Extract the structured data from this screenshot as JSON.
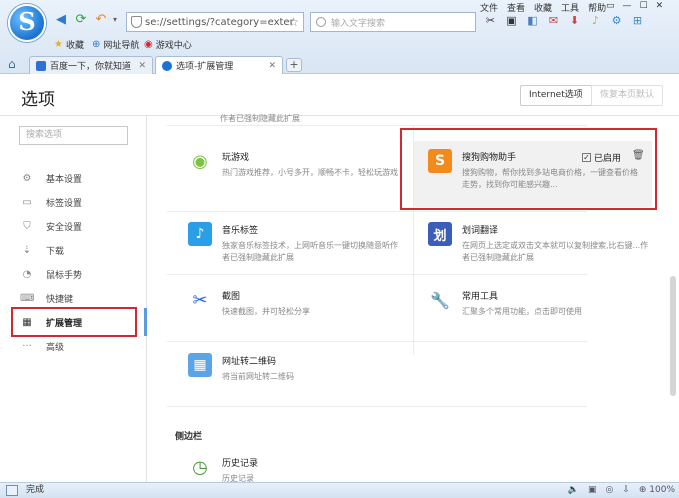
{
  "browser": {
    "logo_letter": "S",
    "address_url": "se://settings/?category=exter",
    "search_placeholder": "输入文字搜索",
    "menu": [
      "文件",
      "查看",
      "收藏",
      "工具",
      "帮助"
    ],
    "window_controls": [
      "▭",
      "—",
      "☐",
      "✕"
    ],
    "toolbar_icons": [
      "✂",
      "▣",
      "◧",
      "✉",
      "⬇",
      "♪",
      "⚙",
      "⊞"
    ],
    "bookmarks": [
      {
        "icon": "★",
        "label": "收藏"
      },
      {
        "icon": "⊕",
        "label": "网址导航"
      },
      {
        "icon": "◉",
        "label": "游戏中心"
      }
    ],
    "tabs": [
      {
        "label": "百度一下，你就知道",
        "active": false,
        "favicon_color": "#2f6fd6"
      },
      {
        "label": "选项-扩展管理",
        "active": true,
        "favicon_color": "#1a73d0"
      }
    ],
    "new_tab": "+"
  },
  "page": {
    "title": "选项",
    "internet_button": "Internet选项",
    "restore_button": "恢复本页默认",
    "sidebar_search_placeholder": "搜索选项",
    "sidebar": [
      {
        "icon": "⚙",
        "label": "基本设置"
      },
      {
        "icon": "▭",
        "label": "标签设置"
      },
      {
        "icon": "⛉",
        "label": "安全设置"
      },
      {
        "icon": "⇣",
        "label": "下载"
      },
      {
        "icon": "◔",
        "label": "鼠标手势"
      },
      {
        "icon": "⌨",
        "label": "快捷键"
      },
      {
        "icon": "▦",
        "label": "扩展管理"
      },
      {
        "icon": "···",
        "label": "高级"
      }
    ],
    "active_sidebar": "扩展管理",
    "top_partial_desc": "作者已强制隐藏此扩展",
    "extensions": [
      {
        "title": "玩游戏",
        "desc": "热门游戏推荐，小号多开，顺畅不卡，轻松玩游戏",
        "icon": "◉",
        "color": "#7cc243"
      },
      {
        "title": "搜狗购物助手",
        "desc": "搜狗购物，帮你找到多站电商价格，一键查看价格走势，找到你可能感兴趣...",
        "icon": "S",
        "color": "#f28a1c",
        "enabled_label": "已启用"
      },
      {
        "title": "音乐标签",
        "desc": "独家音乐标签技术，上网听音乐一键切换随意听作者已强制隐藏此扩展",
        "icon": "♪",
        "color": "#2a9ee6"
      },
      {
        "title": "划词翻译",
        "desc": "在网页上选定或双击文本就可以复制搜索,比右键...作者已强制隐藏此扩展",
        "icon": "划",
        "color": "#3b5fb8"
      },
      {
        "title": "截图",
        "desc": "快速截图，并可轻松分享",
        "icon": "✂",
        "color": "#ffffff"
      },
      {
        "title": "常用工具",
        "desc": "汇聚多个常用功能，点击即可使用",
        "icon": "🔧",
        "color": "#ffffff"
      },
      {
        "title": "网址转二维码",
        "desc": "将当前网址转二维码",
        "icon": "▦",
        "color": "#5ba5e6"
      }
    ],
    "section_sidebar_label": "侧边栏",
    "history": {
      "title": "历史记录",
      "desc": "历史记录",
      "icon": "◷"
    }
  },
  "status": {
    "text": "完成",
    "zoom": "100%"
  }
}
